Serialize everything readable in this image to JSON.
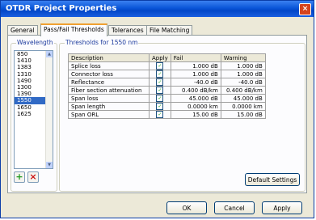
{
  "window": {
    "title": "OTDR Project Properties",
    "close_glyph": "×"
  },
  "tabs": [
    "General",
    "Pass/Fail Thresholds",
    "Tolerances",
    "File Matching"
  ],
  "wavelength": {
    "label": "Wavelength",
    "items": [
      "850",
      "1410",
      "1383",
      "1310",
      "1490",
      "1300",
      "1390",
      "1550",
      "1650",
      "1625"
    ],
    "selected": "1550"
  },
  "thresholds": {
    "label": "Thresholds for 1550 nm",
    "columns": [
      "Description",
      "Apply",
      "Fail",
      "Warning"
    ],
    "rows": [
      {
        "description": "Splice loss",
        "apply": true,
        "fail": "1.000 dB",
        "warning": "1.000 dB"
      },
      {
        "description": "Connector loss",
        "apply": true,
        "fail": "1.000 dB",
        "warning": "1.000 dB"
      },
      {
        "description": "Reflectance",
        "apply": true,
        "fail": "-40.0 dB",
        "warning": "-40.0 dB"
      },
      {
        "description": "Fiber section attenuation",
        "apply": true,
        "fail": "0.400 dB/km",
        "warning": "0.400 dB/km"
      },
      {
        "description": "Span loss",
        "apply": true,
        "fail": "45.000 dB",
        "warning": "45.000 dB"
      },
      {
        "description": "Span length",
        "apply": true,
        "fail": "0.0000 km",
        "warning": "0.0000 km"
      },
      {
        "description": "Span ORL",
        "apply": true,
        "fail": "15.00 dB",
        "warning": "15.00 dB"
      }
    ]
  },
  "icons": {
    "add": "+",
    "remove": "×",
    "check": "✓",
    "scroll_up": "▲",
    "scroll_down": "▼"
  },
  "buttons": {
    "default_settings": "Default Settings",
    "ok": "OK",
    "cancel": "Cancel",
    "apply": "Apply"
  }
}
